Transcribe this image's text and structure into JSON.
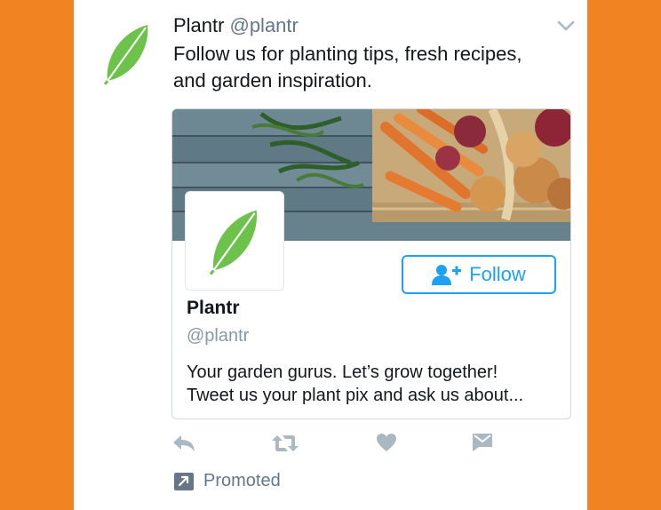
{
  "tweet": {
    "account_name": "Plantr",
    "account_handle": "@plantr",
    "text_line1": "Follow us for planting tips, fresh recipes,",
    "text_line2": "and garden inspiration."
  },
  "card": {
    "name": "Plantr",
    "handle": "@plantr",
    "follow_label": "Follow",
    "bio_line1": "Your garden gurus. Let’s grow together!",
    "bio_line2": "Tweet us your plant pix and ask us about..."
  },
  "footer": {
    "promoted_label": "Promoted"
  },
  "icons": {
    "avatar": "leaf-icon",
    "menu": "chevron-down-icon",
    "follow": "add-user-icon",
    "actions": [
      "reply-icon",
      "retweet-icon",
      "like-icon",
      "direct-message-icon"
    ],
    "promoted": "promoted-arrow-icon"
  },
  "colors": {
    "background": "#F28322",
    "accent": "#1DA1F2",
    "leaf": "#6CC24A",
    "muted": "#657786",
    "action_icons": "#AAB8C2"
  }
}
